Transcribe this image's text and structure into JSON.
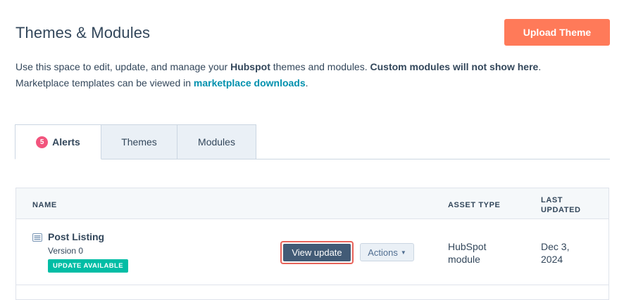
{
  "header": {
    "title": "Themes & Modules",
    "upload_label": "Upload Theme"
  },
  "description": {
    "line1_a": "Use this space to edit, update, and manage your ",
    "line1_b": "Hubspot",
    "line1_c": " themes and modules. ",
    "line1_d": "Custom modules will not show here",
    "line1_e": ".",
    "line2_a": "Marketplace templates can be viewed in ",
    "link_label": "marketplace downloads",
    "line2_b": "."
  },
  "tabs": {
    "alerts_count": "5",
    "alerts_label": "Alerts",
    "themes_label": "Themes",
    "modules_label": "Modules"
  },
  "table": {
    "columns": {
      "name": "NAME",
      "asset_type": "ASSET TYPE",
      "last_updated_1": "LAST",
      "last_updated_2": "UPDATED"
    },
    "rows": [
      {
        "name": "Post Listing",
        "version": "Version 0",
        "status_tag": "UPDATE AVAILABLE",
        "view_label": "View update",
        "actions_label": "Actions",
        "asset_type_1": "HubSpot",
        "asset_type_2": "module",
        "updated_1": "Dec 3,",
        "updated_2": "2024"
      }
    ]
  },
  "colors": {
    "accent": "#ff7a59",
    "link": "#0091ae",
    "badge": "#f2547d",
    "tag": "#00bda5",
    "primary_button": "#425b76",
    "highlight": "#e8635a"
  }
}
